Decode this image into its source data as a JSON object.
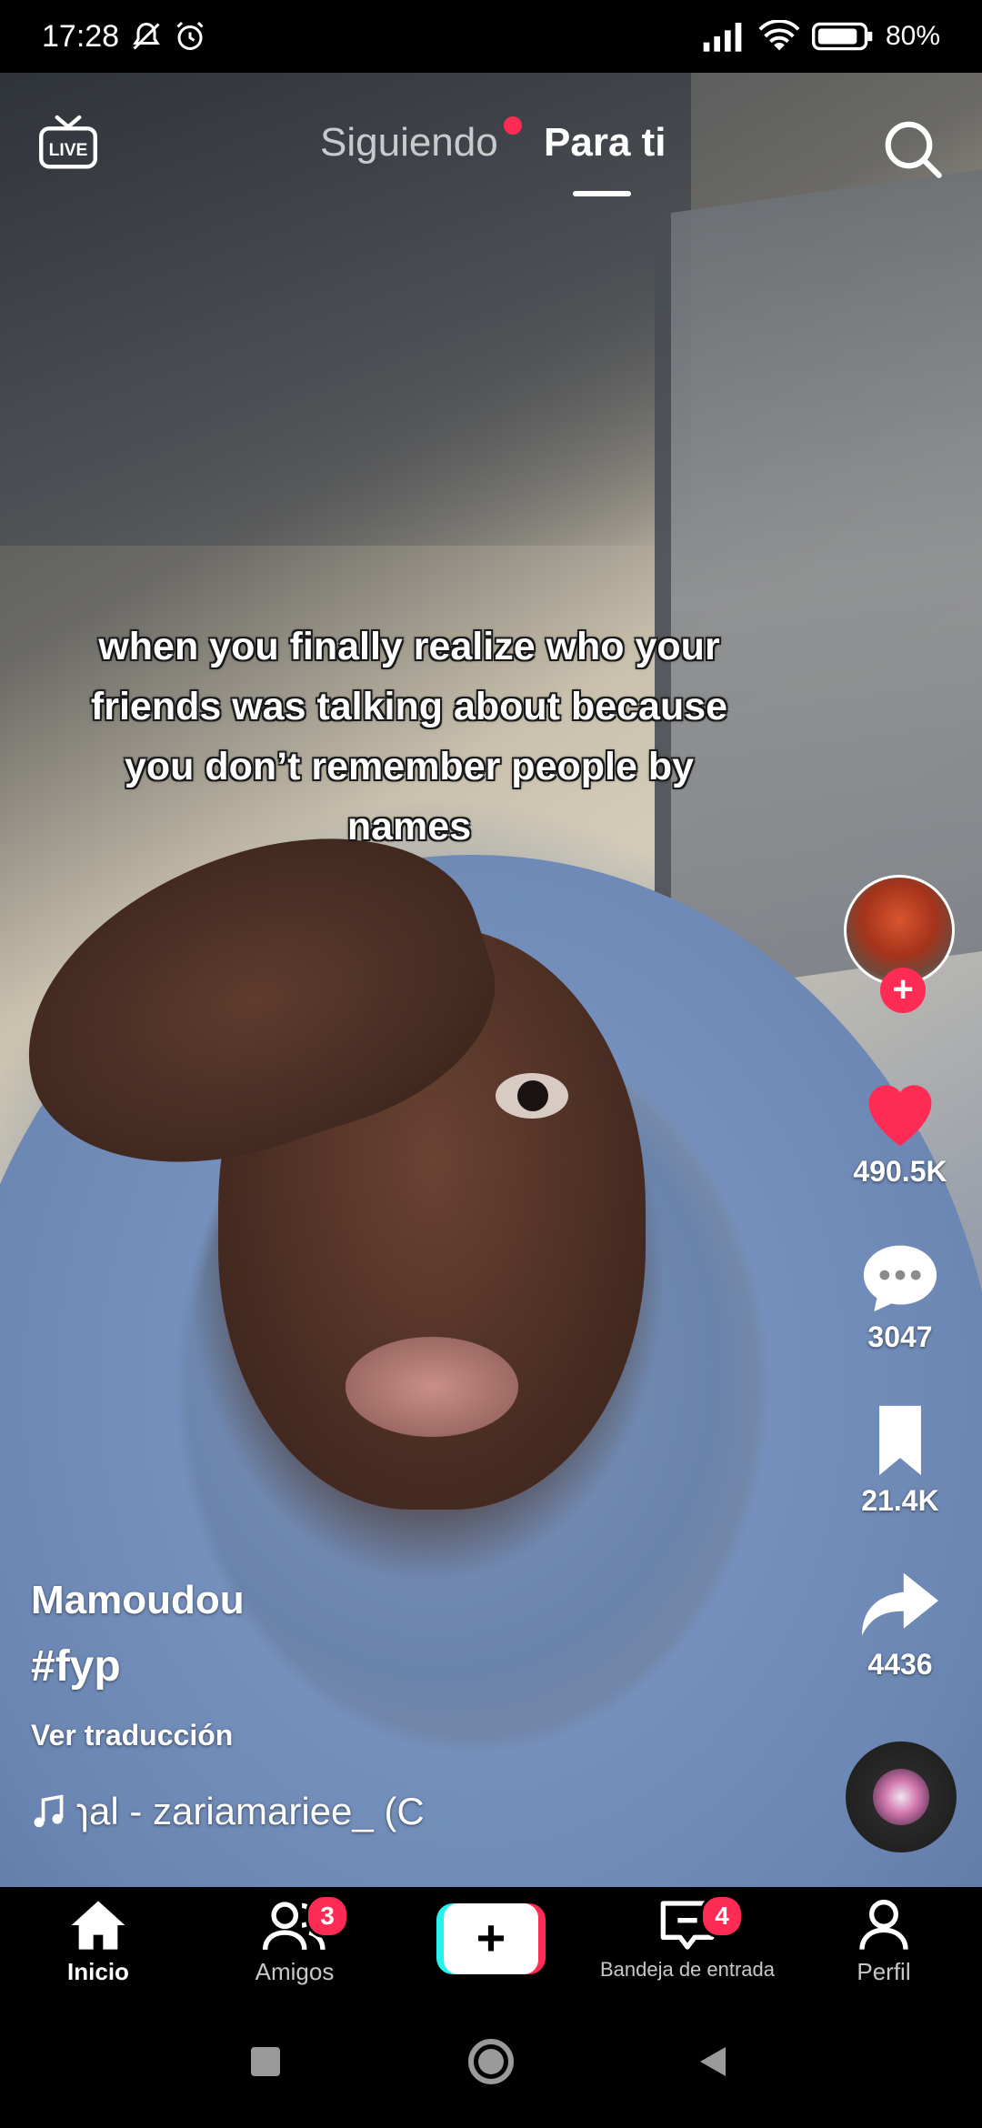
{
  "status": {
    "time": "17:28",
    "battery": "80%",
    "icons": [
      "bell-off-icon",
      "alarm-icon",
      "signal-icon",
      "wifi-icon",
      "battery-icon"
    ]
  },
  "top_nav": {
    "live_icon": "live-tv-icon",
    "tabs": [
      {
        "label": "Siguiendo",
        "has_dot": true
      },
      {
        "label": "Para ti",
        "active": true
      }
    ],
    "search_icon": "search-icon"
  },
  "video": {
    "caption": "when you finally realize who your friends was talking about because you don’t remember people by names"
  },
  "actions": {
    "follow_icon": "plus-icon",
    "likes": "490.5K",
    "comments": "3047",
    "saves": "21.4K",
    "shares": "4436"
  },
  "info": {
    "username": "Mamoudou",
    "hashtag": "#fyp",
    "translate": "Ver traducción",
    "sound": "ɿal - zariamariee_ (C"
  },
  "bottom_nav": {
    "items": [
      {
        "label": "Inicio",
        "icon": "home-icon"
      },
      {
        "label": "Amigos",
        "icon": "friends-icon",
        "badge": "3"
      },
      {
        "label": "",
        "icon": "create-icon"
      },
      {
        "label": "Bandeja de entrada",
        "icon": "inbox-icon",
        "badge": "4"
      },
      {
        "label": "Perfil",
        "icon": "profile-icon"
      }
    ]
  },
  "colors": {
    "accent": "#fe2c55",
    "cyan": "#25f4ee"
  }
}
